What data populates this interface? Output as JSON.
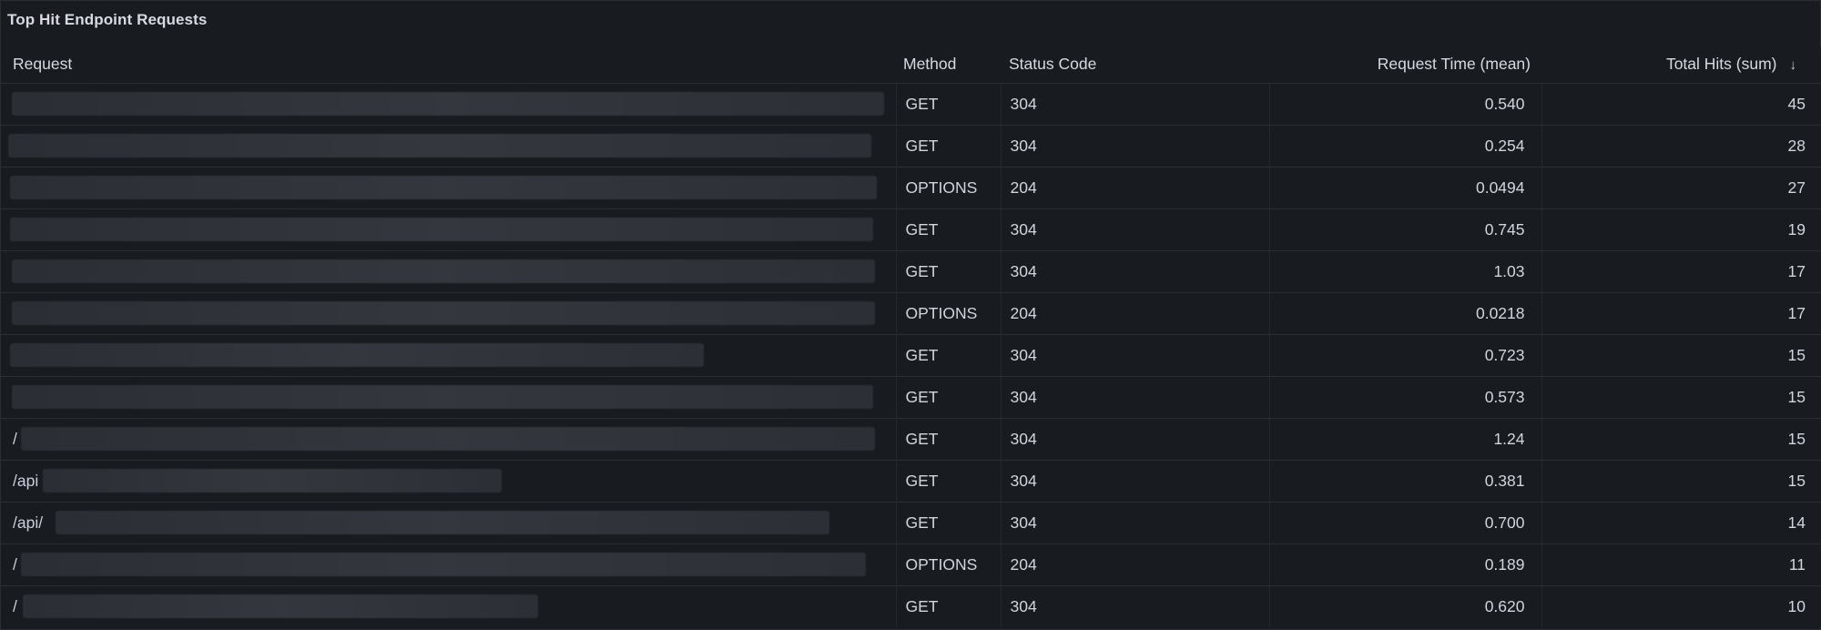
{
  "panel": {
    "title": "Top Hit Endpoint Requests"
  },
  "columns": {
    "request": "Request",
    "method": "Method",
    "status": "Status Code",
    "time": "Request Time (mean)",
    "hits": "Total Hits (sum)",
    "sort_icon": "arrow-down-icon"
  },
  "rows": [
    {
      "request": "",
      "method": "GET",
      "status": "304",
      "time": "0.540",
      "hits": "45"
    },
    {
      "request": "",
      "method": "GET",
      "status": "304",
      "time": "0.254",
      "hits": "28"
    },
    {
      "request": "",
      "method": "OPTIONS",
      "status": "204",
      "time": "0.0494",
      "hits": "27"
    },
    {
      "request": "",
      "method": "GET",
      "status": "304",
      "time": "0.745",
      "hits": "19"
    },
    {
      "request": "",
      "method": "GET",
      "status": "304",
      "time": "1.03",
      "hits": "17"
    },
    {
      "request": "",
      "method": "OPTIONS",
      "status": "204",
      "time": "0.0218",
      "hits": "17"
    },
    {
      "request": "",
      "method": "GET",
      "status": "304",
      "time": "0.723",
      "hits": "15"
    },
    {
      "request": "",
      "method": "GET",
      "status": "304",
      "time": "0.573",
      "hits": "15"
    },
    {
      "request": "/",
      "method": "GET",
      "status": "304",
      "time": "1.24",
      "hits": "15"
    },
    {
      "request": "/api",
      "method": "GET",
      "status": "304",
      "time": "0.381",
      "hits": "15"
    },
    {
      "request": "/api/",
      "method": "GET",
      "status": "304",
      "time": "0.700",
      "hits": "14"
    },
    {
      "request": "/",
      "method": "OPTIONS",
      "status": "204",
      "time": "0.189",
      "hits": "11"
    },
    {
      "request": "/",
      "method": "GET",
      "status": "304",
      "time": "0.620",
      "hits": "10"
    }
  ]
}
